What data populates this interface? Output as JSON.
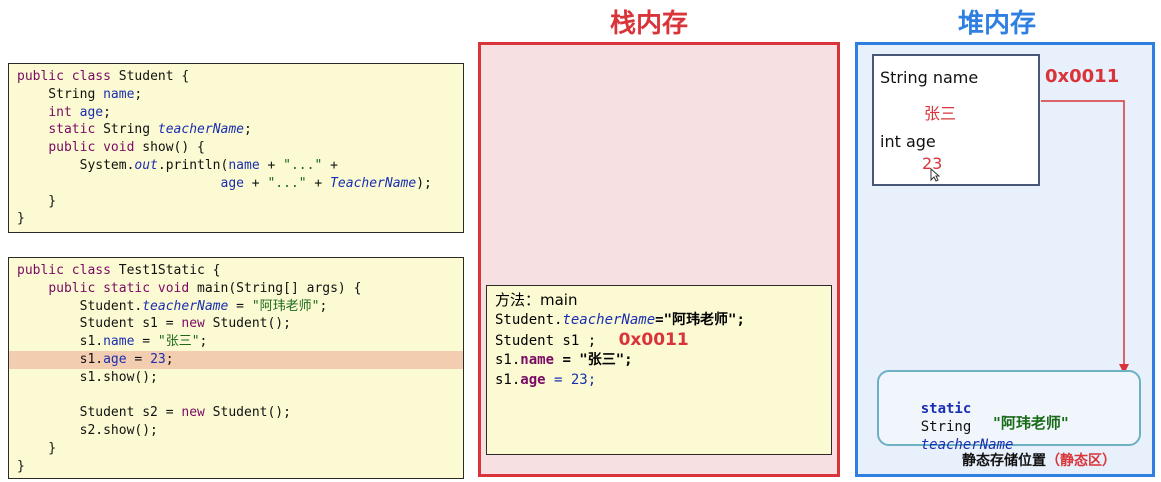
{
  "student_class": {
    "lines": [
      "public class Student {",
      "    String name;",
      "    int age;",
      "    static String teacherName;",
      "    public void show() {",
      "        System.out.println(name + \"...\" +",
      "                          age + \"...\" + TeacherName);",
      "    }",
      "}"
    ]
  },
  "test_class": {
    "lines": [
      "public class Test1Static {",
      "    public static void main(String[] args) {",
      "        Student.teacherName = \"阿玮老师\";",
      "        Student s1 = new Student();",
      "        s1.name = \"张三\";",
      "        s1.age = 23;",
      "        s1.show();",
      "",
      "        Student s2 = new Student();",
      "        s2.show();",
      "    }",
      "}"
    ],
    "highlighted_line": 5
  },
  "stack": {
    "title": "栈内存",
    "frame": {
      "method_label": "方法：main",
      "line1_prefix": "Student.",
      "line1_field": "teacherName",
      "line1_value": "=\"阿玮老师\";",
      "line2": "Student s1 ;",
      "line2_addr": "0x0011",
      "line3_prefix": "s1.",
      "line3_field": "name",
      "line3_value": " = \"张三\";",
      "line4_prefix": "s1.",
      "line4_field": "age",
      "line4_value": " = 23;"
    }
  },
  "heap": {
    "title": "堆内存",
    "object": {
      "name_label": "String name",
      "name_value": "张三",
      "age_label": "int age",
      "age_value": "23",
      "address": "0x0011"
    },
    "static_area": {
      "keyword": "static",
      "type": "String",
      "field": "teacherName",
      "value": "\"阿玮老师\"",
      "caption_main": "静态存储位置",
      "caption_paren": "（静态区）"
    }
  },
  "colors": {
    "stack_border": "#d8343a",
    "heap_border": "#2f7fe2",
    "code_bg": "#fcfad2",
    "highlight": "#f3cdb0"
  }
}
